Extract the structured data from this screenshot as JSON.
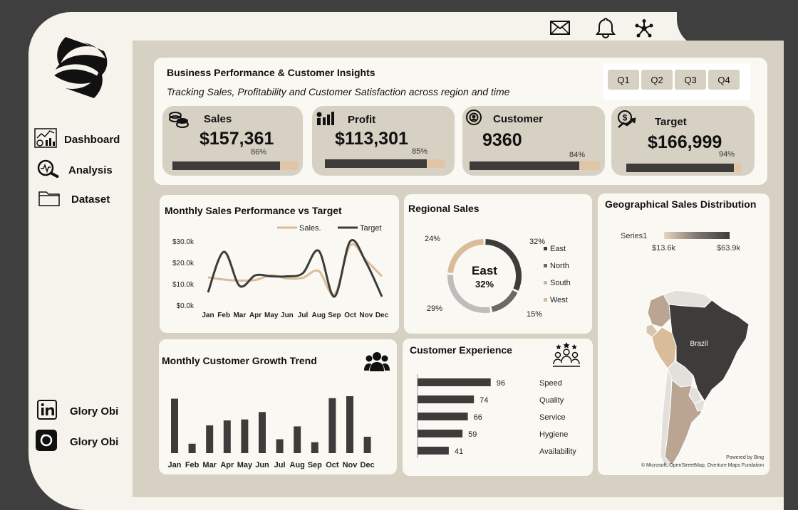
{
  "sidebar": {
    "nav": [
      {
        "label": "Dashboard",
        "icon": "dashboard-chart-icon"
      },
      {
        "label": "Analysis",
        "icon": "analysis-magnifier-icon"
      },
      {
        "label": "Dataset",
        "icon": "folder-icon"
      }
    ],
    "social": [
      {
        "label": "Glory Obi",
        "icon": "linkedin-icon"
      },
      {
        "label": "Glory Obi",
        "icon": "portfolio-icon"
      }
    ]
  },
  "topbar": {
    "icons": [
      "mail-icon",
      "bell-icon",
      "network-icon"
    ]
  },
  "header": {
    "title": "Business Performance & Customer Insights",
    "subtitle": "Tracking Sales, Profitability and Customer Satisfaction across region and time"
  },
  "quarters": [
    "Q1",
    "Q2",
    "Q3",
    "Q4"
  ],
  "kpis": [
    {
      "label": "Sales",
      "value": "$157,361",
      "pct": "86%",
      "fraction": 0.86,
      "icon": "coins-icon"
    },
    {
      "label": "Profit",
      "value": "$113,301",
      "pct": "85%",
      "fraction": 0.85,
      "icon": "profit-bars-icon"
    },
    {
      "label": "Customer",
      "value": "9360",
      "pct": "84%",
      "fraction": 0.84,
      "icon": "customer-target-icon"
    },
    {
      "label": "Target",
      "value": "$166,999",
      "pct": "94%",
      "fraction": 0.94,
      "icon": "target-growth-icon"
    }
  ],
  "colors": {
    "accent": "#d9bc9a",
    "dark": "#3e3c3a",
    "panel": "#faf8f2",
    "background": "#d7d1c3"
  },
  "charts": {
    "monthly_sales": {
      "title": "Monthly Sales Performance vs Target",
      "legend": [
        "Sales.",
        "Target"
      ],
      "yticks": [
        "$30.0k",
        "$20.0k",
        "$10.0k",
        "$0.0k"
      ]
    },
    "regional": {
      "title": "Regional Sales",
      "center_label": "East",
      "center_value": "32%",
      "legend": [
        "East",
        "North",
        "South",
        "West"
      ],
      "labels": [
        "32%",
        "15%",
        "29%",
        "24%"
      ]
    },
    "growth": {
      "title": "Monthly Customer Growth Trend"
    },
    "experience": {
      "title": "Customer Experience"
    },
    "geo": {
      "title": "Geographical Sales Distribution",
      "legend_series": "Series1",
      "legend_min": "$13.6k",
      "legend_max": "$63.9k",
      "country_label": "Brazil",
      "credit1": "Powered by Bing",
      "credit2": "© Microsoft, OpenStreetMap, Overture Maps Fundation"
    }
  },
  "chart_data": [
    {
      "type": "line",
      "title": "Monthly Sales Performance vs Target",
      "x": [
        "Jan",
        "Feb",
        "Mar",
        "Apr",
        "May",
        "Jun",
        "Jul",
        "Aug",
        "Sep",
        "Oct",
        "Nov",
        "Dec"
      ],
      "series": [
        {
          "name": "Sales.",
          "values": [
            13000,
            12000,
            11500,
            11800,
            14000,
            12500,
            12800,
            16000,
            5000,
            28000,
            21000,
            13500
          ]
        },
        {
          "name": "Target",
          "values": [
            6000,
            25000,
            9000,
            14000,
            13500,
            13500,
            15000,
            25500,
            4000,
            30000,
            20000,
            4000
          ]
        }
      ],
      "ylim": [
        0,
        30000
      ],
      "colors": [
        "#d9bc9a",
        "#3e3c3a"
      ]
    },
    {
      "type": "pie",
      "title": "Regional Sales",
      "categories": [
        "East",
        "North",
        "South",
        "West"
      ],
      "values": [
        32,
        15,
        29,
        24
      ],
      "colors": [
        "#3e3c3a",
        "#6b6966",
        "#bfbdbb",
        "#d9bc9a"
      ]
    },
    {
      "type": "bar",
      "title": "Monthly Customer Growth Trend",
      "categories": [
        "Jan",
        "Feb",
        "Mar",
        "Apr",
        "May",
        "Jun",
        "Jul",
        "Aug",
        "Sep",
        "Oct",
        "Nov",
        "Dec"
      ],
      "values": [
        1100,
        190,
        560,
        660,
        680,
        830,
        280,
        540,
        220,
        1110,
        1150,
        330
      ]
    },
    {
      "type": "bar",
      "title": "Customer Experience",
      "categories": [
        "Speed",
        "Quality",
        "Service",
        "Hygiene",
        "Availability"
      ],
      "values": [
        96,
        74,
        66,
        59,
        41
      ]
    }
  ]
}
